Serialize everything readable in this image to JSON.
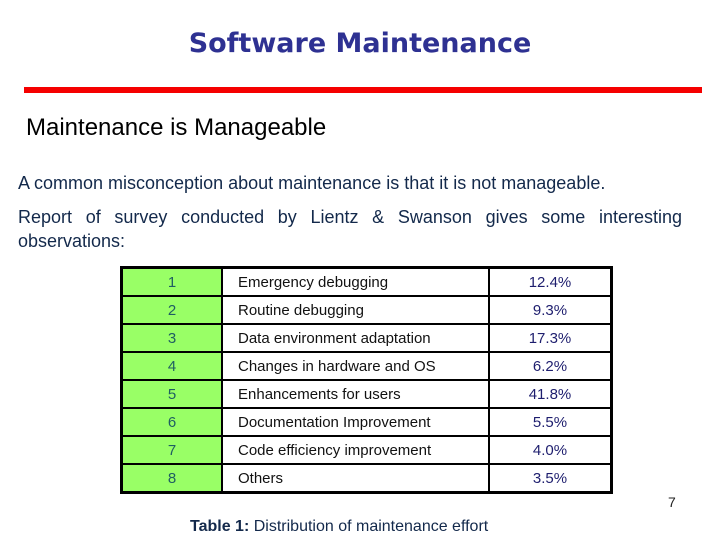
{
  "slide": {
    "title": "Software Maintenance",
    "subtitle": "Maintenance is Manageable",
    "paragraphs": [
      "A common misconception about maintenance is that it is not manageable.",
      "Report of survey conducted by Lientz & Swanson gives some interesting observations:"
    ],
    "colors": {
      "title": "#2e3192",
      "rule": "#f50000",
      "number_column_bg": "#99ff66"
    },
    "page_number": "7"
  },
  "table": {
    "rows": [
      {
        "num": "1",
        "activity": "Emergency debugging",
        "effort": "12.4%"
      },
      {
        "num": "2",
        "activity": "Routine debugging",
        "effort": "9.3%"
      },
      {
        "num": "3",
        "activity": "Data environment adaptation",
        "effort": "17.3%"
      },
      {
        "num": "4",
        "activity": "Changes in hardware and OS",
        "effort": "6.2%"
      },
      {
        "num": "5",
        "activity": "Enhancements for users",
        "effort": "41.8%"
      },
      {
        "num": "6",
        "activity": "Documentation Improvement",
        "effort": "5.5%"
      },
      {
        "num": "7",
        "activity": "Code efficiency improvement",
        "effort": "4.0%"
      },
      {
        "num": "8",
        "activity": "Others",
        "effort": "3.5%"
      }
    ],
    "caption_label": "Table 1:",
    "caption_text": " Distribution of maintenance effort"
  }
}
